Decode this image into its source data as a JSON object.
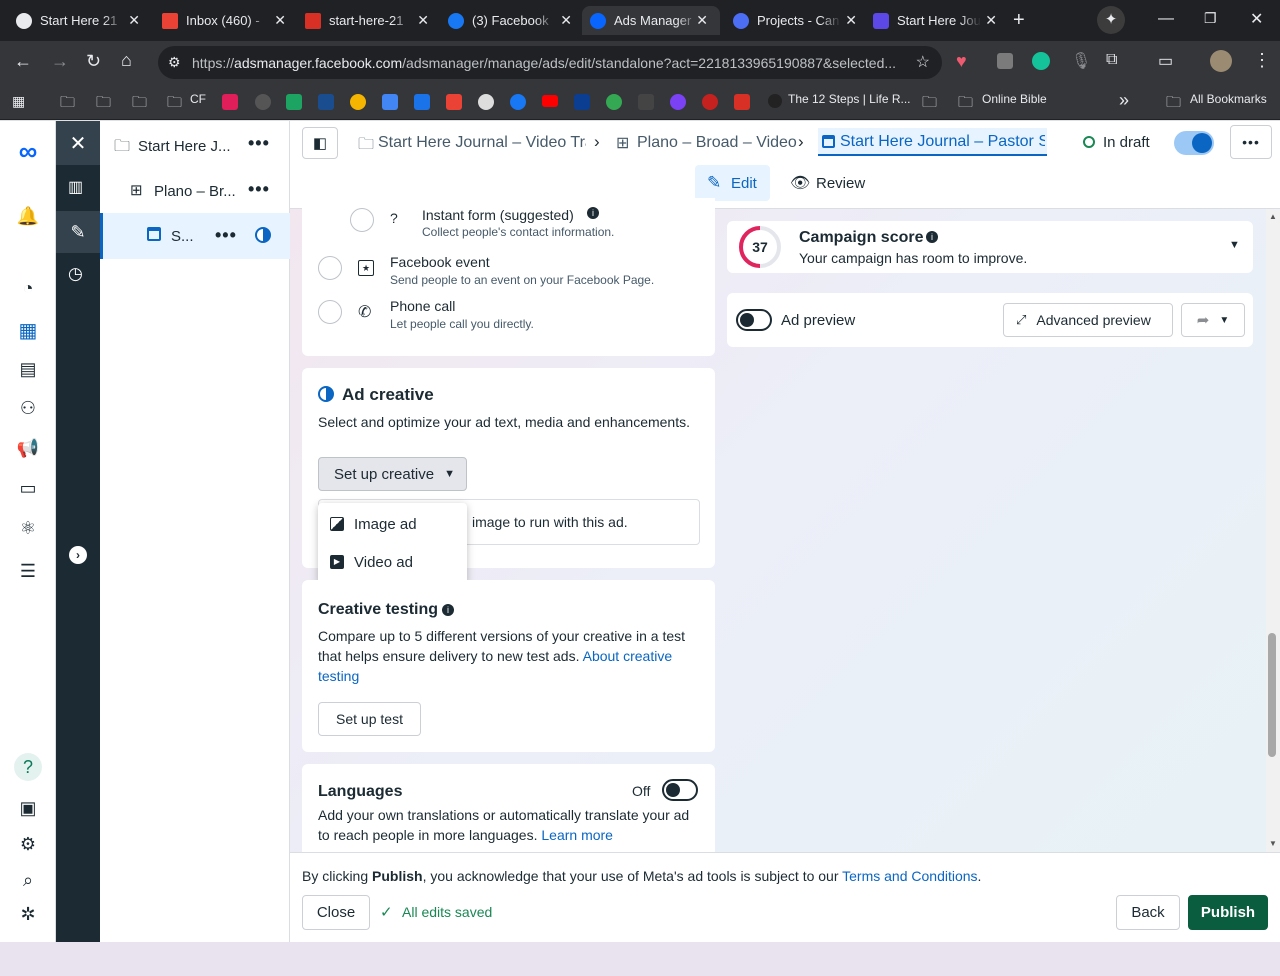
{
  "browser": {
    "tabs": [
      {
        "title": "Start Here 21",
        "color": "#e8eaed"
      },
      {
        "title": "Inbox (460) -",
        "color": "#ea4335"
      },
      {
        "title": "start-here-21",
        "color": "#d93025"
      },
      {
        "title": "(3) Facebook",
        "color": "#1877f2"
      },
      {
        "title": "Ads Manager",
        "color": "#0866ff"
      },
      {
        "title": "Projects - Can",
        "color": "#4c6ef5"
      },
      {
        "title": "Start Here Jou",
        "color": "#5c48e6"
      }
    ],
    "new_tab": "+",
    "url_host": "adsmanager.facebook.com",
    "url_prefix": "https://",
    "url_rest": "/adsmanager/manage/ads/edit/standalone?act=2218133965190887&selected...",
    "bookmarks": {
      "cf": "CF",
      "twelve_steps": "The 12 Steps | Life R...",
      "online_bible": "Online Bible",
      "more": "»",
      "all_bookmarks": "All Bookmarks"
    }
  },
  "tree": {
    "campaign": "Start Here J...",
    "adset": "Plano – Br...",
    "ad": "S..."
  },
  "breadcrumb": {
    "campaign": "Start Here Journal – Video Traf",
    "adset": "Plano – Broad – Video",
    "ad": "Start Here Journal – Pastor Ste",
    "status": "In draft"
  },
  "modes": {
    "edit": "Edit",
    "review": "Review"
  },
  "destinations": [
    {
      "title": "Instant form (suggested)",
      "desc": "Collect people's contact information."
    },
    {
      "title": "Facebook event",
      "desc": "Send people to an event on your Facebook Page."
    },
    {
      "title": "Phone call",
      "desc": "Let people call you directly."
    }
  ],
  "ad_creative": {
    "title": "Ad creative",
    "desc": "Select and optimize your ad text, media and enhancements.",
    "setup_button": "Set up creative",
    "hint": "image to run with this ad.",
    "menu": [
      "Image ad",
      "Video ad"
    ]
  },
  "creative_testing": {
    "title": "Creative testing",
    "desc": "Compare up to 5 different versions of your creative in a test that helps ensure delivery to new test ads.",
    "link": "About creative testing",
    "button": "Set up test"
  },
  "languages": {
    "title": "Languages",
    "toggle_label": "Off",
    "desc": "Add your own translations or automatically translate your ad to reach people in more languages.",
    "link": "Learn more"
  },
  "campaign_score": {
    "score": "37",
    "title": "Campaign score",
    "desc": "Your campaign has room to improve."
  },
  "preview": {
    "label": "Ad preview",
    "advanced": "Advanced preview"
  },
  "footer": {
    "pre": "By clicking ",
    "publish_word": "Publish",
    "mid": ", you acknowledge that your use of Meta's ad tools is subject to our ",
    "terms": "Terms and Conditions",
    "end": ".",
    "close": "Close",
    "saved": "All edits saved",
    "back": "Back",
    "publish": "Publish"
  },
  "colors": {
    "accent": "#0a66c2",
    "publish": "#0a5d3f",
    "score_ring": "#e0245e",
    "rail_dark": "#1c2b33"
  }
}
